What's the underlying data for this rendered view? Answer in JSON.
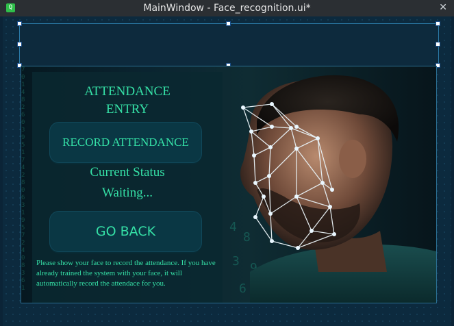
{
  "window": {
    "title": "MainWindow - Face_recognition.ui*",
    "app_icon_glyph": "Q",
    "close_glyph": "✕"
  },
  "panel": {
    "heading_line1": "ATTENDANCE",
    "heading_line2": "ENTRY",
    "record_button": "RECORD ATTENDANCE",
    "status_label": "Current Status",
    "status_value": "Waiting...",
    "back_button": "GO BACK",
    "info_text": "Please show your face to record the attendance. If you have already trained the system with your face, it will automatically record the attendace for you."
  },
  "colors": {
    "accent": "#35e0a6",
    "button_bg": "#0a3744",
    "panel_bg": "#0a2830",
    "selection": "#2b7aa7"
  }
}
